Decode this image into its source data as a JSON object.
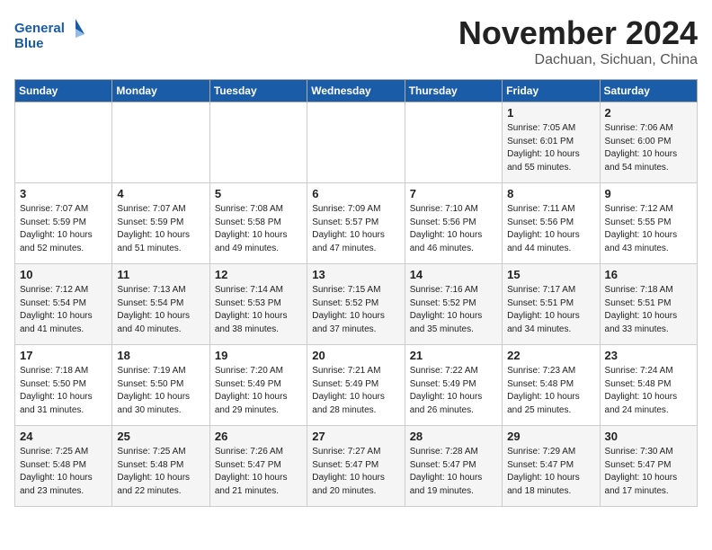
{
  "header": {
    "logo_line1": "General",
    "logo_line2": "Blue",
    "month": "November 2024",
    "location": "Dachuan, Sichuan, China"
  },
  "weekdays": [
    "Sunday",
    "Monday",
    "Tuesday",
    "Wednesday",
    "Thursday",
    "Friday",
    "Saturday"
  ],
  "weeks": [
    [
      {
        "day": "",
        "info": ""
      },
      {
        "day": "",
        "info": ""
      },
      {
        "day": "",
        "info": ""
      },
      {
        "day": "",
        "info": ""
      },
      {
        "day": "",
        "info": ""
      },
      {
        "day": "1",
        "info": "Sunrise: 7:05 AM\nSunset: 6:01 PM\nDaylight: 10 hours\nand 55 minutes."
      },
      {
        "day": "2",
        "info": "Sunrise: 7:06 AM\nSunset: 6:00 PM\nDaylight: 10 hours\nand 54 minutes."
      }
    ],
    [
      {
        "day": "3",
        "info": "Sunrise: 7:07 AM\nSunset: 5:59 PM\nDaylight: 10 hours\nand 52 minutes."
      },
      {
        "day": "4",
        "info": "Sunrise: 7:07 AM\nSunset: 5:59 PM\nDaylight: 10 hours\nand 51 minutes."
      },
      {
        "day": "5",
        "info": "Sunrise: 7:08 AM\nSunset: 5:58 PM\nDaylight: 10 hours\nand 49 minutes."
      },
      {
        "day": "6",
        "info": "Sunrise: 7:09 AM\nSunset: 5:57 PM\nDaylight: 10 hours\nand 47 minutes."
      },
      {
        "day": "7",
        "info": "Sunrise: 7:10 AM\nSunset: 5:56 PM\nDaylight: 10 hours\nand 46 minutes."
      },
      {
        "day": "8",
        "info": "Sunrise: 7:11 AM\nSunset: 5:56 PM\nDaylight: 10 hours\nand 44 minutes."
      },
      {
        "day": "9",
        "info": "Sunrise: 7:12 AM\nSunset: 5:55 PM\nDaylight: 10 hours\nand 43 minutes."
      }
    ],
    [
      {
        "day": "10",
        "info": "Sunrise: 7:12 AM\nSunset: 5:54 PM\nDaylight: 10 hours\nand 41 minutes."
      },
      {
        "day": "11",
        "info": "Sunrise: 7:13 AM\nSunset: 5:54 PM\nDaylight: 10 hours\nand 40 minutes."
      },
      {
        "day": "12",
        "info": "Sunrise: 7:14 AM\nSunset: 5:53 PM\nDaylight: 10 hours\nand 38 minutes."
      },
      {
        "day": "13",
        "info": "Sunrise: 7:15 AM\nSunset: 5:52 PM\nDaylight: 10 hours\nand 37 minutes."
      },
      {
        "day": "14",
        "info": "Sunrise: 7:16 AM\nSunset: 5:52 PM\nDaylight: 10 hours\nand 35 minutes."
      },
      {
        "day": "15",
        "info": "Sunrise: 7:17 AM\nSunset: 5:51 PM\nDaylight: 10 hours\nand 34 minutes."
      },
      {
        "day": "16",
        "info": "Sunrise: 7:18 AM\nSunset: 5:51 PM\nDaylight: 10 hours\nand 33 minutes."
      }
    ],
    [
      {
        "day": "17",
        "info": "Sunrise: 7:18 AM\nSunset: 5:50 PM\nDaylight: 10 hours\nand 31 minutes."
      },
      {
        "day": "18",
        "info": "Sunrise: 7:19 AM\nSunset: 5:50 PM\nDaylight: 10 hours\nand 30 minutes."
      },
      {
        "day": "19",
        "info": "Sunrise: 7:20 AM\nSunset: 5:49 PM\nDaylight: 10 hours\nand 29 minutes."
      },
      {
        "day": "20",
        "info": "Sunrise: 7:21 AM\nSunset: 5:49 PM\nDaylight: 10 hours\nand 28 minutes."
      },
      {
        "day": "21",
        "info": "Sunrise: 7:22 AM\nSunset: 5:49 PM\nDaylight: 10 hours\nand 26 minutes."
      },
      {
        "day": "22",
        "info": "Sunrise: 7:23 AM\nSunset: 5:48 PM\nDaylight: 10 hours\nand 25 minutes."
      },
      {
        "day": "23",
        "info": "Sunrise: 7:24 AM\nSunset: 5:48 PM\nDaylight: 10 hours\nand 24 minutes."
      }
    ],
    [
      {
        "day": "24",
        "info": "Sunrise: 7:25 AM\nSunset: 5:48 PM\nDaylight: 10 hours\nand 23 minutes."
      },
      {
        "day": "25",
        "info": "Sunrise: 7:25 AM\nSunset: 5:48 PM\nDaylight: 10 hours\nand 22 minutes."
      },
      {
        "day": "26",
        "info": "Sunrise: 7:26 AM\nSunset: 5:47 PM\nDaylight: 10 hours\nand 21 minutes."
      },
      {
        "day": "27",
        "info": "Sunrise: 7:27 AM\nSunset: 5:47 PM\nDaylight: 10 hours\nand 20 minutes."
      },
      {
        "day": "28",
        "info": "Sunrise: 7:28 AM\nSunset: 5:47 PM\nDaylight: 10 hours\nand 19 minutes."
      },
      {
        "day": "29",
        "info": "Sunrise: 7:29 AM\nSunset: 5:47 PM\nDaylight: 10 hours\nand 18 minutes."
      },
      {
        "day": "30",
        "info": "Sunrise: 7:30 AM\nSunset: 5:47 PM\nDaylight: 10 hours\nand 17 minutes."
      }
    ]
  ]
}
